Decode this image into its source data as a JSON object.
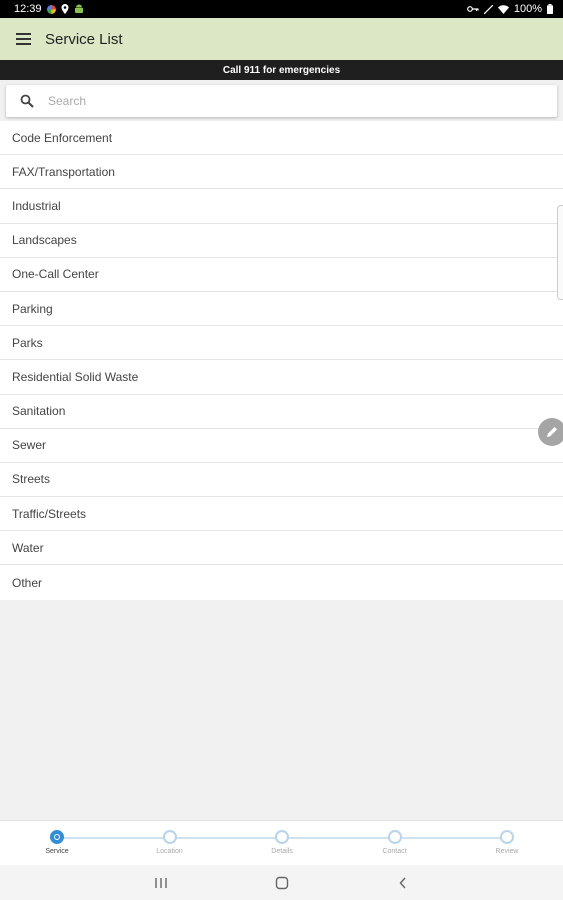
{
  "status_bar": {
    "time": "12:39",
    "battery": "100%"
  },
  "app_bar": {
    "title": "Service List"
  },
  "emergency_banner": "Call 911 for emergencies",
  "search": {
    "placeholder": "Search",
    "value": ""
  },
  "services": [
    "Code Enforcement",
    "FAX/Transportation",
    "Industrial",
    "Landscapes",
    "One-Call Center",
    "Parking",
    "Parks",
    "Residential Solid Waste",
    "Sanitation",
    "Sewer",
    "Streets",
    "Traffic/Streets",
    "Water",
    "Other"
  ],
  "steps": [
    {
      "label": "Service",
      "active": true
    },
    {
      "label": "Location",
      "active": false
    },
    {
      "label": "Details",
      "active": false
    },
    {
      "label": "Contact",
      "active": false
    },
    {
      "label": "Review",
      "active": false
    }
  ],
  "icons": {
    "menu": "hamburger-icon",
    "search": "search-icon",
    "edit": "pencil-icon",
    "nav_recents": "recents-icon",
    "nav_home": "home-icon",
    "nav_back": "back-icon"
  },
  "colors": {
    "app_bar": "#dce8c5",
    "emergency_bar": "#1f1f1f",
    "step_active": "#2f8fd8",
    "step_inactive": "#b9d4ea"
  }
}
